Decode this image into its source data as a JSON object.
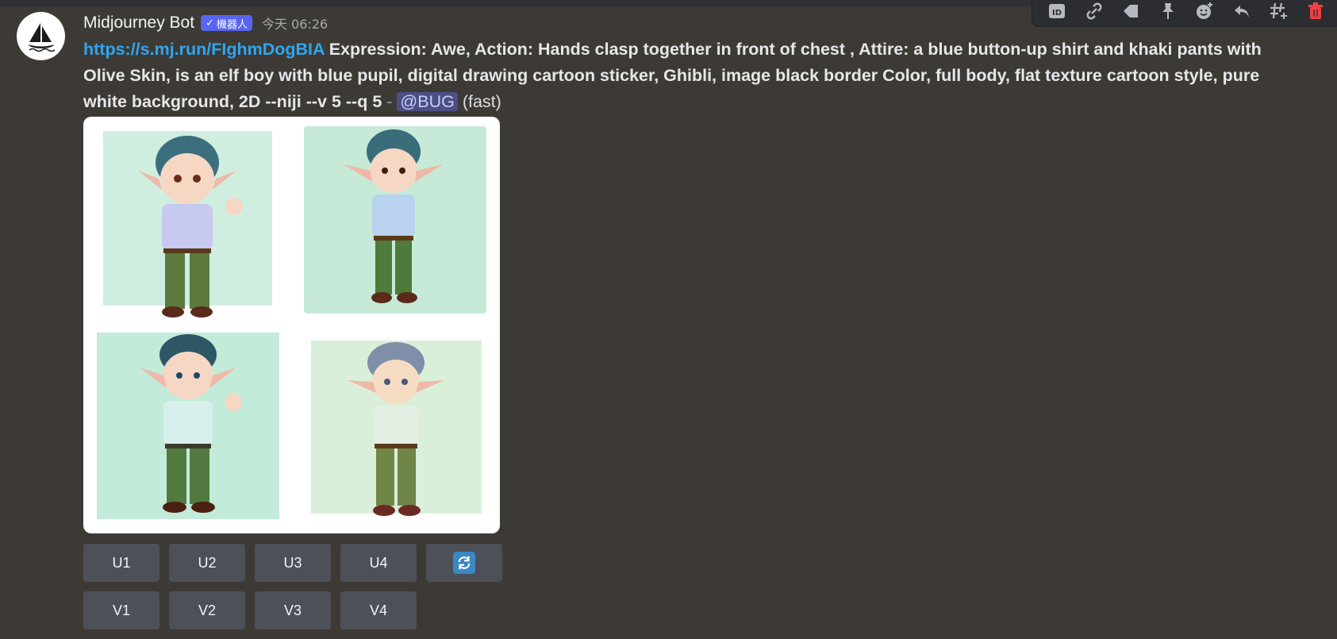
{
  "author": {
    "name": "Midjourney Bot",
    "badge": "機器人",
    "badge_check": "✓",
    "timestamp": "今天 06:26"
  },
  "message": {
    "link": "https://s.mj.run/FIghmDogBIA",
    "prompt": "Expression: Awe, Action: Hands clasp together in front of chest , Attire: a blue button-up shirt and khaki pants with Olive Skin, is an elf boy with blue pupil, digital drawing cartoon sticker, Ghibli, image black border Color, full body, flat texture cartoon style, pure white background, 2D --niji --v 5 --q 5",
    "separator": "-",
    "mention": "@BUG",
    "speed": "(fast)"
  },
  "upscale_buttons": [
    "U1",
    "U2",
    "U3",
    "U4"
  ],
  "variation_buttons": [
    "V1",
    "V2",
    "V3",
    "V4"
  ],
  "reroll_icon": "reroll-icon",
  "toolbar_icons": [
    "id-icon",
    "link-icon",
    "tag-icon",
    "pin-icon",
    "add-reaction-icon",
    "reply-icon",
    "thread-icon",
    "delete-icon"
  ],
  "colors": {
    "background": "#3d3a36",
    "link": "#2fa6f0",
    "bot_badge": "#5865f2",
    "button": "#4e5058",
    "delete": "#f23f42"
  }
}
